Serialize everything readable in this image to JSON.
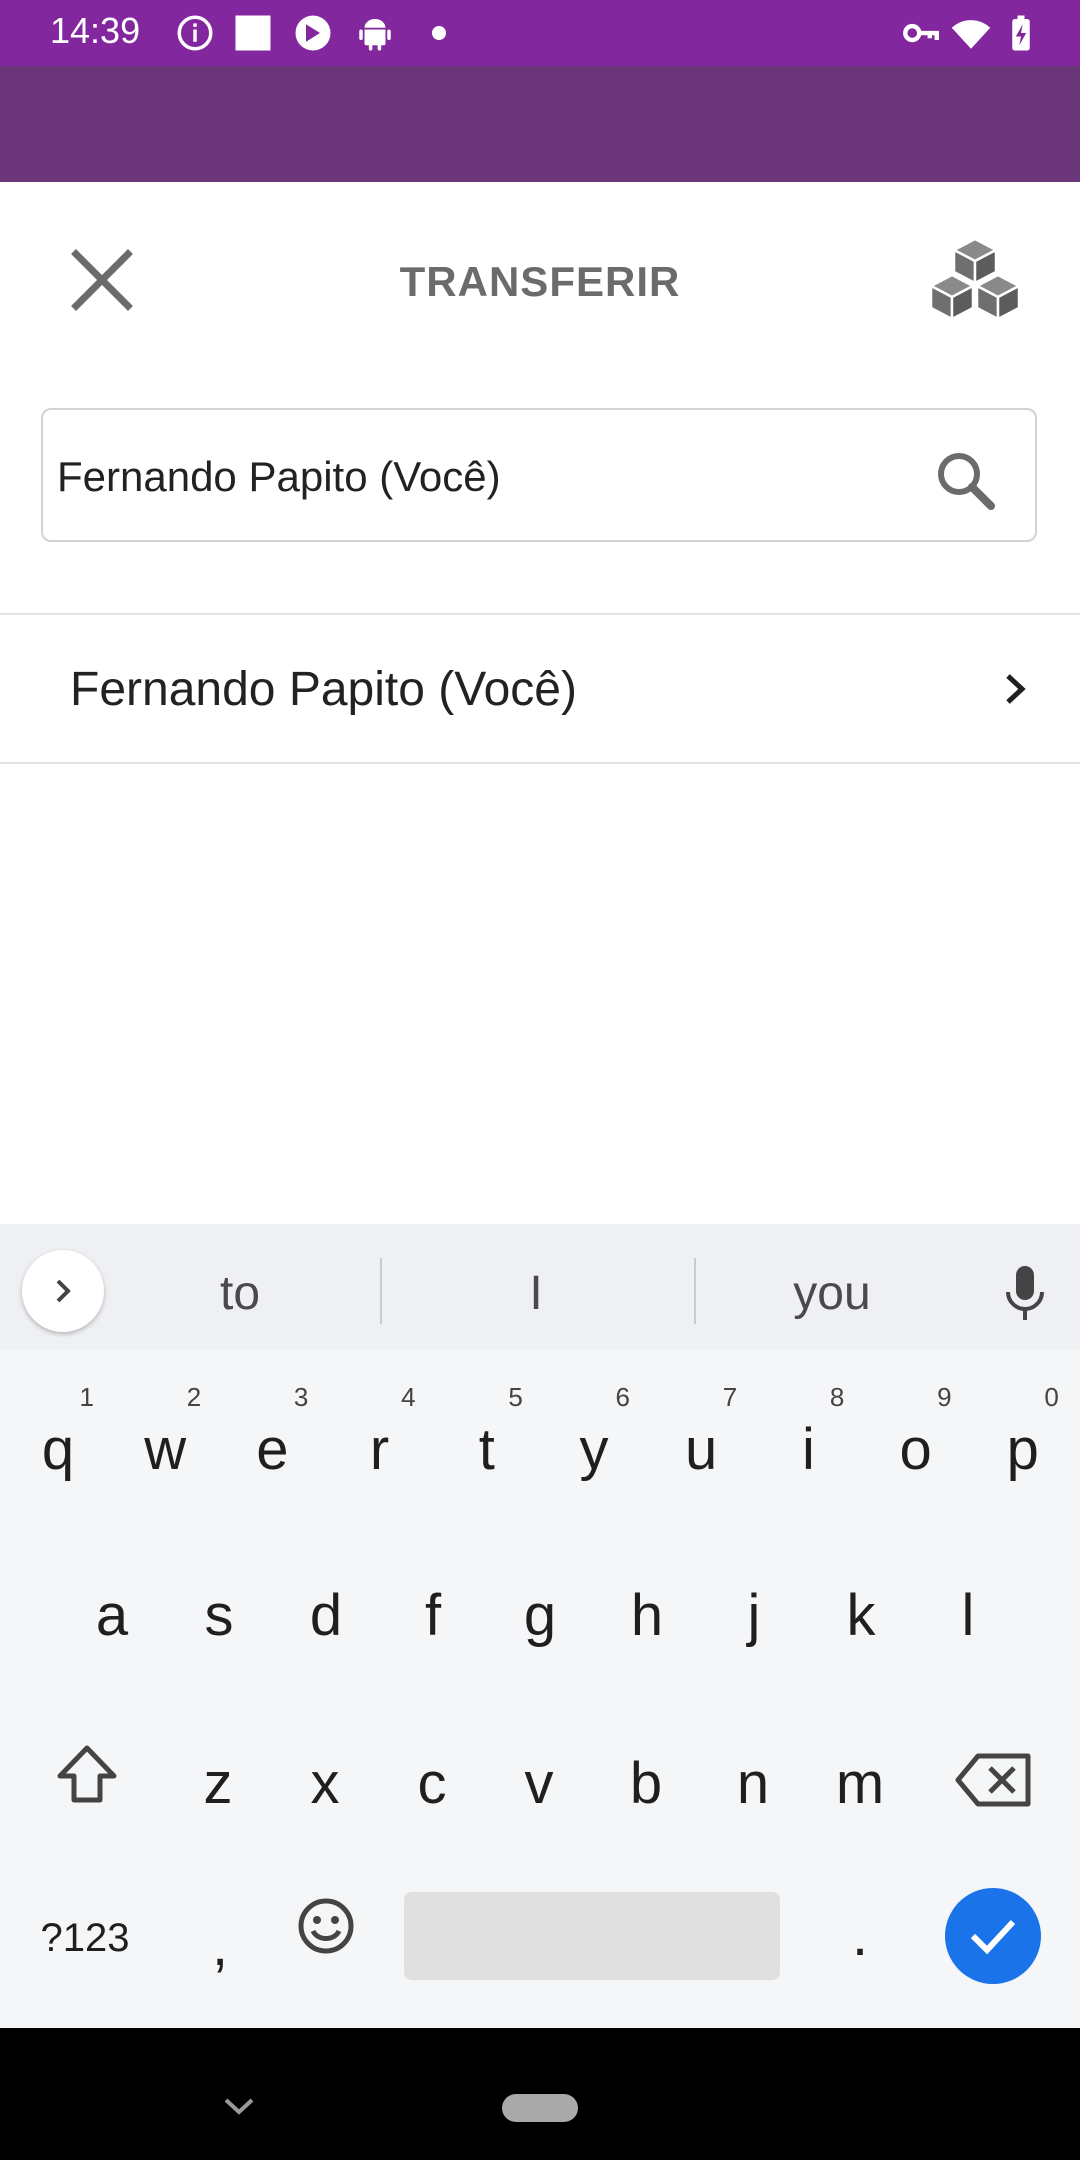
{
  "status_bar": {
    "time": "14:39",
    "icons": [
      "info-icon",
      "square-icon",
      "app-icon",
      "android-icon",
      "dot-icon",
      "key-icon",
      "wifi-icon",
      "battery-icon"
    ]
  },
  "header": {
    "title": "TRANSFERIR",
    "close_icon": "close-icon",
    "right_icon": "cubes-icon"
  },
  "search": {
    "value": "Fernando Papito (Você)",
    "icon": "search-icon"
  },
  "results": [
    {
      "label": "Fernando Papito (Você)",
      "icon": "chevron-right-icon"
    }
  ],
  "keyboard": {
    "suggestions": [
      "to",
      "I",
      "you"
    ],
    "row1": [
      {
        "k": "q",
        "n": "1"
      },
      {
        "k": "w",
        "n": "2"
      },
      {
        "k": "e",
        "n": "3"
      },
      {
        "k": "r",
        "n": "4"
      },
      {
        "k": "t",
        "n": "5"
      },
      {
        "k": "y",
        "n": "6"
      },
      {
        "k": "u",
        "n": "7"
      },
      {
        "k": "i",
        "n": "8"
      },
      {
        "k": "o",
        "n": "9"
      },
      {
        "k": "p",
        "n": "0"
      }
    ],
    "row2": [
      "a",
      "s",
      "d",
      "f",
      "g",
      "h",
      "j",
      "k",
      "l"
    ],
    "row3": [
      "z",
      "x",
      "c",
      "v",
      "b",
      "n",
      "m"
    ],
    "symbols_label": "?123",
    "comma": ",",
    "period": "."
  },
  "colors": {
    "status_bar": "#83279f",
    "app_bar": "#6a3579",
    "enter_button": "#1a73e8"
  }
}
